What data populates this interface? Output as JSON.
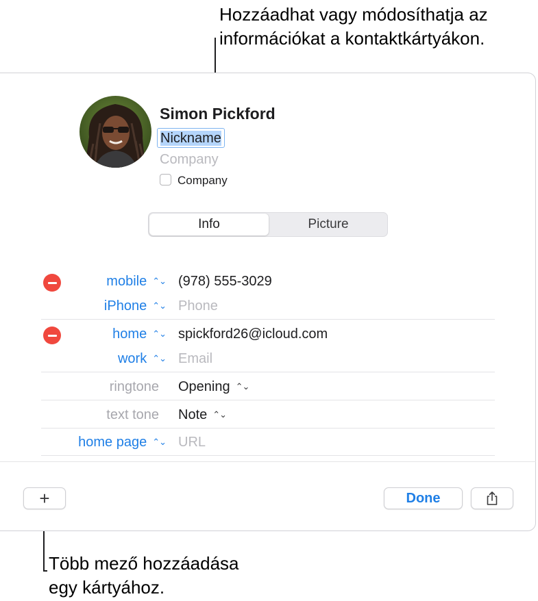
{
  "callouts": {
    "top_line1": "Hozzáadhat vagy módosíthatja az",
    "top_line2": "információkat a kontaktkártyákon.",
    "bottom_line1": "Több mező hozzáadása",
    "bottom_line2": "egy kártyához."
  },
  "contact": {
    "name": "Simon  Pickford",
    "nickname": "Nickname",
    "company_placeholder": "Company",
    "company_checkbox_label": "Company",
    "company_checked": false
  },
  "tabs": {
    "info": "Info",
    "picture": "Picture",
    "selected": "Info"
  },
  "fields": {
    "phone1_label": "mobile",
    "phone1_value": "(978) 555-3029",
    "phone2_label": "iPhone",
    "phone2_placeholder": "Phone",
    "email1_label": "home",
    "email1_value": "spickford26@icloud.com",
    "email2_label": "work",
    "email2_placeholder": "Email",
    "ringtone_label": "ringtone",
    "ringtone_value": "Opening",
    "texttone_label": "text tone",
    "texttone_value": "Note",
    "homepage_label": "home page",
    "homepage_placeholder": "URL"
  },
  "footer": {
    "add_label": "+",
    "done_label": "Done"
  },
  "colors": {
    "accent": "#1f7fe6",
    "remove": "#f0483e",
    "selection": "#b4d5fb"
  },
  "icons": {
    "remove": "minus-circle-icon",
    "chevron": "up-down-chevron-icon",
    "share": "share-icon"
  }
}
